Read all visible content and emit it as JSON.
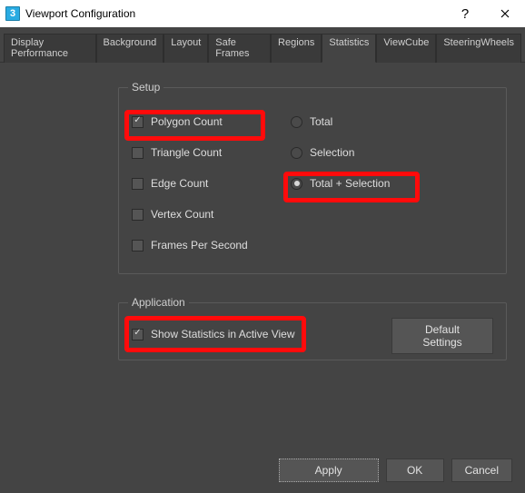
{
  "window": {
    "title": "Viewport Configuration",
    "icon_label": "3"
  },
  "tabs": [
    "Display Performance",
    "Background",
    "Layout",
    "Safe Frames",
    "Regions",
    "Statistics",
    "ViewCube",
    "SteeringWheels"
  ],
  "active_tab_index": 5,
  "setup": {
    "legend": "Setup",
    "left": {
      "polygon": "Polygon Count",
      "triangle": "Triangle Count",
      "edge": "Edge Count",
      "vertex": "Vertex Count",
      "fps": "Frames Per Second"
    },
    "left_checked": {
      "polygon": true,
      "triangle": false,
      "edge": false,
      "vertex": false,
      "fps": false
    },
    "right": {
      "total": "Total",
      "selection": "Selection",
      "total_selection": "Total + Selection"
    },
    "right_selected": "total_selection"
  },
  "application": {
    "legend": "Application",
    "show_stats": "Show Statistics in Active View",
    "show_stats_checked": true,
    "default_btn": "Default Settings"
  },
  "footer": {
    "apply": "Apply",
    "ok": "OK",
    "cancel": "Cancel"
  }
}
